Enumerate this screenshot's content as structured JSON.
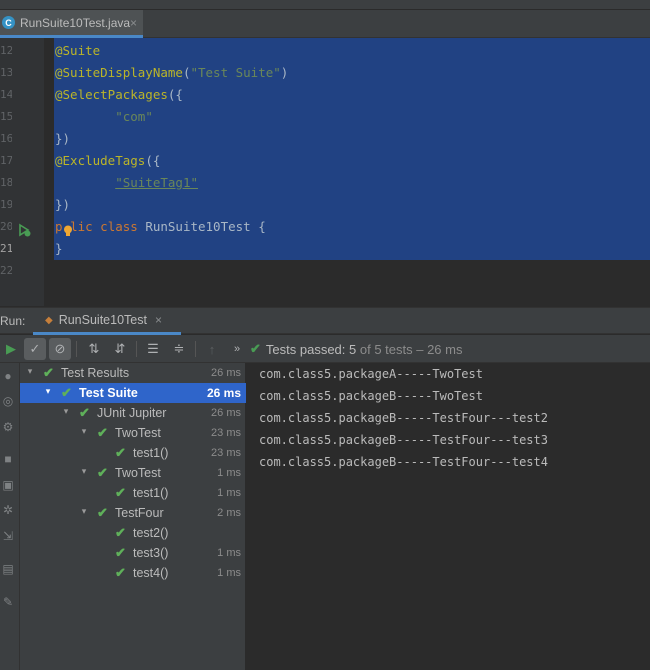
{
  "editor_tab": {
    "label": "RunSuite10Test.java",
    "close": "×"
  },
  "code_lines": [
    {
      "num": "12",
      "tokens": [
        {
          "cls": "ann",
          "text": "@Suite"
        }
      ]
    },
    {
      "num": "13",
      "tokens": [
        {
          "cls": "ann",
          "text": "@SuiteDisplayName"
        },
        {
          "cls": "",
          "text": "("
        },
        {
          "cls": "str",
          "text": "\"Test Suite\""
        },
        {
          "cls": "",
          "text": ")"
        }
      ]
    },
    {
      "num": "14",
      "tokens": [
        {
          "cls": "ann",
          "text": "@SelectPackages"
        },
        {
          "cls": "",
          "text": "({"
        }
      ]
    },
    {
      "num": "15",
      "tokens": [
        {
          "cls": "",
          "text": "        "
        },
        {
          "cls": "str",
          "text": "\"com\""
        }
      ]
    },
    {
      "num": "16",
      "tokens": [
        {
          "cls": "",
          "text": "})"
        }
      ]
    },
    {
      "num": "17",
      "tokens": [
        {
          "cls": "ann",
          "text": "@ExcludeTags"
        },
        {
          "cls": "",
          "text": "({"
        }
      ]
    },
    {
      "num": "18",
      "tokens": [
        {
          "cls": "",
          "text": "        "
        },
        {
          "cls": "str u",
          "text": "\"SuiteTag1\""
        }
      ]
    },
    {
      "num": "19",
      "tokens": [
        {
          "cls": "",
          "text": "})"
        }
      ]
    },
    {
      "num": "20",
      "tokens": [
        {
          "cls": "kw",
          "text": "p"
        },
        {
          "cls": "",
          "text": " "
        },
        {
          "cls": "kw",
          "text": "lic class "
        },
        {
          "cls": "",
          "text": "RunSuite10Test {"
        }
      ]
    },
    {
      "num": "21",
      "tokens": [
        {
          "cls": "",
          "text": "}"
        }
      ]
    },
    {
      "num": "22",
      "tokens": []
    }
  ],
  "run_window": {
    "label": "Run:",
    "tab_label": "RunSuite10Test",
    "tab_close": "×"
  },
  "toolbar": {
    "status_prefix": "Tests passed: ",
    "passed": "5",
    "status_suffix": " of 5 tests – 26 ms"
  },
  "tree": [
    {
      "name": "Test Results",
      "time": "26 ms",
      "indent": 0,
      "chevron": "down",
      "selected": false
    },
    {
      "name": "Test Suite",
      "time": "26 ms",
      "indent": 1,
      "chevron": "down",
      "selected": true
    },
    {
      "name": "JUnit Jupiter",
      "time": "26 ms",
      "indent": 2,
      "chevron": "down",
      "selected": false
    },
    {
      "name": "TwoTest",
      "time": "23 ms",
      "indent": 3,
      "chevron": "down",
      "selected": false
    },
    {
      "name": "test1()",
      "time": "23 ms",
      "indent": 4,
      "chevron": "",
      "selected": false
    },
    {
      "name": "TwoTest",
      "time": "1 ms",
      "indent": 3,
      "chevron": "down",
      "selected": false
    },
    {
      "name": "test1()",
      "time": "1 ms",
      "indent": 4,
      "chevron": "",
      "selected": false
    },
    {
      "name": "TestFour",
      "time": "2 ms",
      "indent": 3,
      "chevron": "down",
      "selected": false
    },
    {
      "name": "test2()",
      "time": "",
      "indent": 4,
      "chevron": "",
      "selected": false
    },
    {
      "name": "test3()",
      "time": "1 ms",
      "indent": 4,
      "chevron": "",
      "selected": false
    },
    {
      "name": "test4()",
      "time": "1 ms",
      "indent": 4,
      "chevron": "",
      "selected": false
    }
  ],
  "console": [
    "com.class5.packageA-----TwoTest",
    "com.class5.packageB-----TwoTest",
    "com.class5.packageB-----TestFour---test2",
    "com.class5.packageB-----TestFour---test3",
    "com.class5.packageB-----TestFour---test4"
  ],
  "colors": {
    "accent": "#4a88c7",
    "selection": "#214283",
    "tree_selected": "#2f65ca",
    "pass_green": "#5fb05a"
  }
}
